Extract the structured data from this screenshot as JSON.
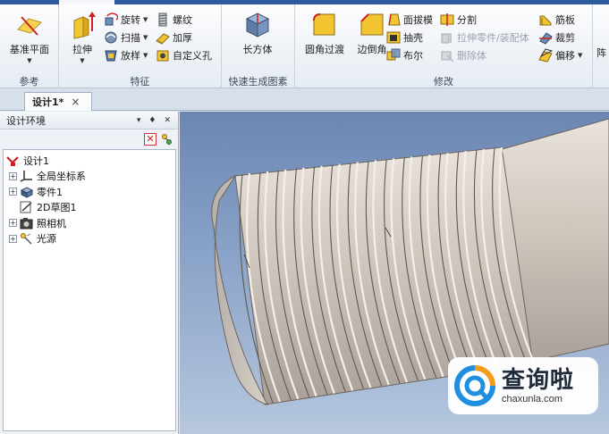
{
  "ribbon": {
    "groups": {
      "reference": {
        "label": "参考",
        "datum_plane": "基准平面"
      },
      "features": {
        "label": "特征",
        "extrude": "拉伸",
        "revolve": "旋转",
        "sweep": "扫描",
        "loft": "放样",
        "thread": "螺纹",
        "thicken": "加厚",
        "custom_hole": "自定义孔"
      },
      "quick_shapes": {
        "label": "快速生成图素",
        "box": "长方体"
      },
      "modify": {
        "label": "修改",
        "fillet": "圆角过渡",
        "chamfer": "边倒角",
        "draft": "面拔模",
        "shell": "抽壳",
        "boolean": "布尔",
        "split": "分割",
        "extrude_part": "拉伸零件/装配体",
        "delete_body": "删除体",
        "rib": "筋板",
        "trim": "裁剪",
        "offset": "偏移",
        "more": "阵"
      }
    }
  },
  "doc_tab": {
    "title": "设计1*",
    "close": "×"
  },
  "panel": {
    "title": "设计环境",
    "controls": [
      "▾",
      "♦",
      "✕"
    ],
    "tree": [
      {
        "label": "设计1",
        "icon": "design-root-icon",
        "level": 0
      },
      {
        "label": "全局坐标系",
        "icon": "coordinate-system-icon",
        "level": 1
      },
      {
        "label": "零件1",
        "icon": "part-icon",
        "level": 1
      },
      {
        "label": "2D草图1",
        "icon": "sketch-icon",
        "level": 1
      },
      {
        "label": "照相机",
        "icon": "camera-icon",
        "level": 1
      },
      {
        "label": "光源",
        "icon": "light-icon",
        "level": 1
      }
    ]
  },
  "viewport": {
    "background_top": "#6b86b3",
    "background_bottom": "#b6c7de",
    "model": "threaded-bolt"
  },
  "watermark": {
    "brand": "查询啦",
    "url": "chaxunla.com"
  },
  "colors": {
    "ribbon_strip": "#2c5a9a",
    "accent_yellow": "#f2c531",
    "thread_metal": "#c9bfb6"
  }
}
